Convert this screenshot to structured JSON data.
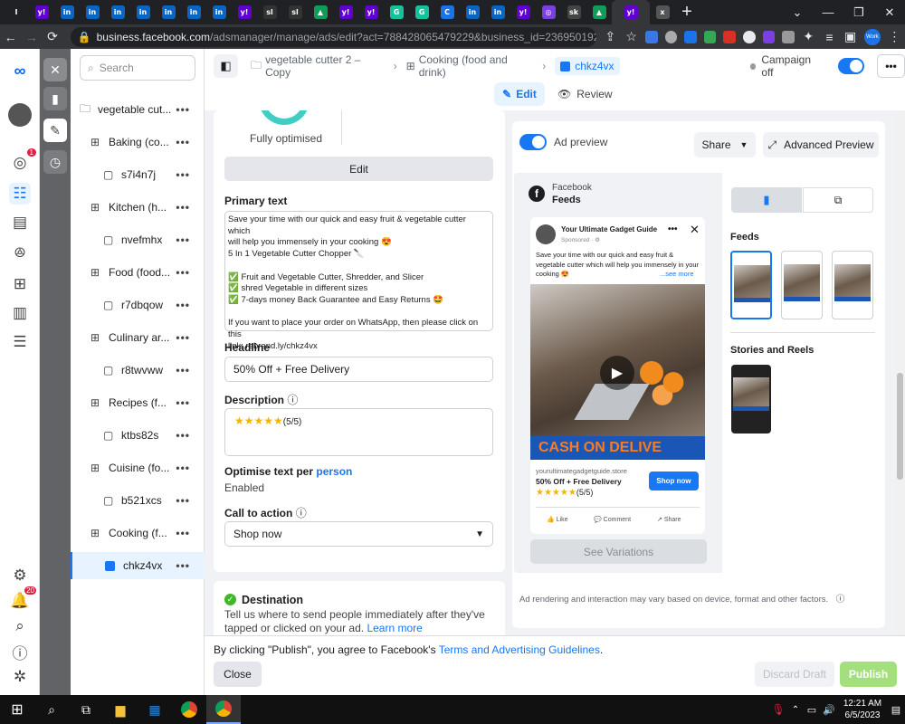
{
  "browser": {
    "url_host": "business.facebook.com",
    "url_path": "/adsmanager/manage/ads/edit?act=788428065479229&business_id=23695019217...",
    "tab_glyphs": [
      "I",
      "y!",
      "in",
      "in",
      "in",
      "in",
      "in",
      "in",
      "in",
      "y!",
      "sl",
      "sl",
      "▲",
      "y!",
      "y!",
      "G",
      "G",
      "C",
      "in",
      "in",
      "y!",
      "◎",
      "sk",
      "▲",
      "y!",
      "x"
    ],
    "new_tab": "+",
    "profile_badge": "Work"
  },
  "rail": {
    "notif_count": "1",
    "bell_count": "20"
  },
  "tree": {
    "search_placeholder": "Search",
    "items": [
      {
        "label": "vegetable cut...",
        "type": "campaign"
      },
      {
        "label": "Baking (co...",
        "type": "adset"
      },
      {
        "label": "s7i4n7j",
        "type": "ad"
      },
      {
        "label": "Kitchen (h...",
        "type": "adset"
      },
      {
        "label": "nvefmhx",
        "type": "ad"
      },
      {
        "label": "Food (food...",
        "type": "adset"
      },
      {
        "label": "r7dbqow",
        "type": "ad"
      },
      {
        "label": "Culinary ar...",
        "type": "adset"
      },
      {
        "label": "r8twvww",
        "type": "ad"
      },
      {
        "label": "Recipes (f...",
        "type": "adset"
      },
      {
        "label": "ktbs82s",
        "type": "ad"
      },
      {
        "label": "Cuisine (fo...",
        "type": "adset"
      },
      {
        "label": "b521xcs",
        "type": "ad"
      },
      {
        "label": "Cooking (f...",
        "type": "adset"
      },
      {
        "label": "chkz4vx",
        "type": "ad-selected"
      }
    ],
    "more_glyph": "•••"
  },
  "header": {
    "crumb_campaign": "vegetable cutter 2 – Copy",
    "crumb_adset": "Cooking (food and drink)",
    "crumb_ad": "chkz4vx",
    "status": "Campaign off",
    "edit_label": "Edit",
    "review_label": "Review"
  },
  "form": {
    "optimised_label": "Fully optimised",
    "edit_btn": "Edit",
    "primary_text_label": "Primary text",
    "primary_text_lines": [
      "Save your time with our quick and easy fruit & vegetable cutter which",
      "will help you immensely in your cooking 😍",
      "5 In 1 Vegetable Cutter Chopper 🔪",
      "",
      "✅ Fruit and Vegetable Cutter, Shredder, and Slicer",
      "✅ shred Vegetable in different sizes",
      "✅ 7-days money Back Guarantee and Easy Returns 🤩",
      "",
      "If you want to place your order on WhatsApp, then please click on this",
      "link: rebrand.ly/chkz4vx"
    ],
    "headline_label": "Headline",
    "headline_value": "50% Off + Free Delivery",
    "description_label": "Description",
    "description_stars": "★★★★★",
    "description_rating": "(5/5)",
    "optimise_label": "Optimise text per",
    "optimise_link": "person",
    "optimise_value": "Enabled",
    "cta_label": "Call to action",
    "cta_value": "Shop now",
    "destination_title": "Destination",
    "destination_text": "Tell us where to send people immediately after they've",
    "destination_text2": "tapped or clicked on your ad.",
    "learn_more": "Learn more"
  },
  "preview": {
    "toggle_label": "Ad preview",
    "share_label": "Share",
    "advanced_label": "Advanced Preview",
    "platform": "Facebook",
    "placement": "Feeds",
    "page_name": "Your Ultimate Gadget Guide",
    "sponsored": "Sponsored · ⚙",
    "ad_text": "Save your time with our quick and easy fruit & vegetable cutter which will help you immensely in your cooking 😍",
    "see_more": "...see more",
    "image_banner": "CASH ON DELIVE",
    "domain": "yourultimategadgetguide.store",
    "headline": "50% Off + Free Delivery",
    "stars": "★★★★★",
    "rating": "(5/5)",
    "shop_now": "Shop now",
    "like": "Like",
    "comment": "Comment",
    "share": "Share",
    "see_variations": "See Variations",
    "feeds_label": "Feeds",
    "stories_label": "Stories and Reels",
    "disclaimer": "Ad rendering and interaction may vary based on device, format and other factors."
  },
  "footer": {
    "agree_text": "By clicking \"Publish\", you agree to Facebook's",
    "terms_link": "Terms and Advertising Guidelines",
    "close_label": "Close",
    "discard_label": "Discard Draft",
    "publish_label": "Publish"
  },
  "taskbar": {
    "time": "12:21 AM",
    "date": "6/5/2023"
  },
  "colors": {
    "accent": "#1877f2",
    "banner": "#1a56b5",
    "publish": "#a3e07d"
  }
}
